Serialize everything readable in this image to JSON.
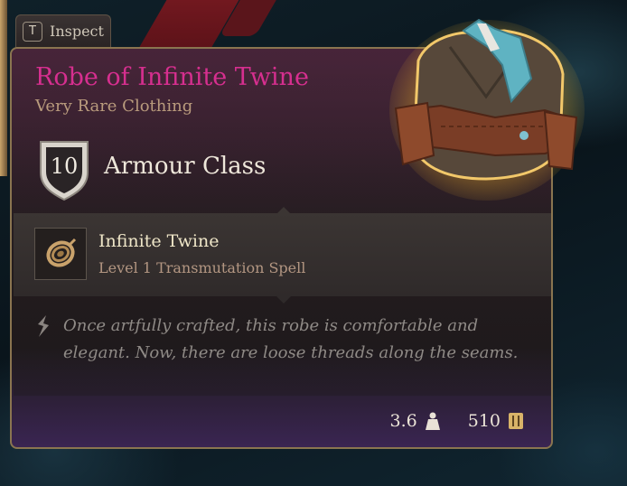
{
  "inspect": {
    "key": "T",
    "label": "Inspect"
  },
  "item": {
    "name": "Robe of Infinite Twine",
    "rarity": "Very Rare Clothing",
    "name_color": "#d62f8f",
    "image_icon": "robe-icon"
  },
  "armour": {
    "value": "10",
    "label": "Armour Class"
  },
  "spell": {
    "name": "Infinite Twine",
    "level": "Level 1 Transmutation Spell",
    "icon": "rope-coil-icon"
  },
  "description": "Once artfully crafted, this robe is comfortable and elegant. Now, there are loose threads along the seams.",
  "footer": {
    "weight": "3.6",
    "weight_icon": "weight-icon",
    "gold": "510",
    "gold_icon": "gold-coin-icon"
  }
}
